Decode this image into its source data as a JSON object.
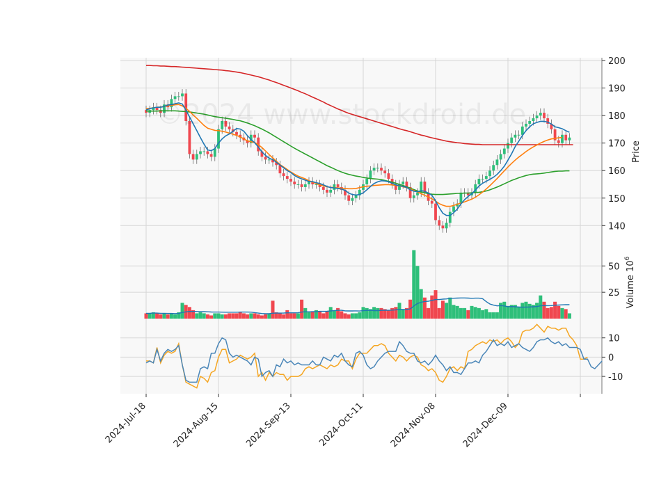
{
  "watermark": "©2024 www.stockdroid.de",
  "colors": {
    "up": "#2ebf7a",
    "down": "#f0474f",
    "panel_bg": "#f8f8f8",
    "grid": "#d6d6d6",
    "ma_short": "#1f77b4",
    "ma_mid": "#ff7f0e",
    "ma_long": "#2ca02c",
    "ma_200": "#d62728",
    "volume_ma": "#1f77b4",
    "osc_fast": "#4a86b8",
    "osc_slow": "#f5a623"
  },
  "chart_data": [
    {
      "type": "candlestick",
      "ylabel": "Price",
      "ylim": [
        133,
        201
      ],
      "yticks": [
        140,
        150,
        160,
        170,
        180,
        190,
        200
      ],
      "xtick_labels": [
        "2024-Jul-18",
        "2024-Aug-15",
        "2024-Sep-13",
        "2024-Oct-11",
        "2024-Nov-08",
        "2024-Dec-09"
      ],
      "xtick_index": [
        0,
        20,
        40,
        60,
        80,
        100
      ],
      "grid": true,
      "close": [
        181,
        182,
        183,
        182,
        181,
        184,
        183,
        186,
        187,
        187,
        188,
        178,
        166,
        164,
        166,
        167,
        167,
        166,
        165,
        168,
        175,
        178,
        176,
        175,
        174,
        173,
        172,
        171,
        170,
        173,
        172,
        167,
        165,
        164,
        164,
        163,
        162,
        159,
        158,
        157,
        156,
        155,
        155,
        154,
        155,
        156,
        155,
        155,
        154,
        153,
        152,
        153,
        155,
        154,
        153,
        151,
        149,
        150,
        151,
        153,
        155,
        157,
        160,
        161,
        161,
        160,
        159,
        157,
        155,
        153,
        155,
        156,
        154,
        150,
        151,
        152,
        156,
        152,
        149,
        148,
        142,
        140,
        139,
        141,
        145,
        147,
        148,
        152,
        152,
        151,
        152,
        155,
        157,
        157,
        158,
        160,
        162,
        164,
        166,
        168,
        170,
        172,
        173,
        173,
        176,
        177,
        178,
        179,
        180,
        181,
        179,
        177,
        175,
        171,
        170,
        173,
        171,
        172
      ],
      "series": [
        {
          "name": "MA short",
          "values": [
            182,
            182.5,
            182.8,
            183,
            183,
            183.3,
            183.8,
            184,
            184.3,
            184.6,
            184.2,
            182,
            179.5,
            177,
            174.5,
            172,
            169.6,
            167.5,
            167.2,
            168,
            170,
            171.5,
            172.6,
            173.3,
            174.3,
            175.3,
            175.1,
            174.3,
            172.7,
            171.3,
            170.1,
            168.6,
            166.8,
            165.5,
            164.5,
            164,
            163,
            162,
            161,
            160,
            159.3,
            158.2,
            157.5,
            157,
            156.5,
            156,
            156,
            155.6,
            155.3,
            154.8,
            154.2,
            153.8,
            153.7,
            153.5,
            153.3,
            152.8,
            151.8,
            151.3,
            151.1,
            151.3,
            151.9,
            153,
            154.2,
            155.3,
            155.9,
            156.3,
            156.2,
            155.9,
            155.4,
            154.8,
            154.5,
            154.2,
            153.9,
            153,
            152.5,
            152.3,
            152.7,
            152.5,
            151.8,
            151,
            149,
            146.5,
            144.5,
            143.7,
            143.7,
            144.7,
            146,
            147.9,
            149.4,
            150.6,
            151.6,
            152.9,
            154.4,
            155.4,
            156.1,
            156.8,
            157.6,
            158.6,
            160,
            161.6,
            163.8,
            166.1,
            168.7,
            170.7,
            172.8,
            174.5,
            175.9,
            177,
            177.5,
            177.9,
            177.9,
            177.6,
            176.9,
            175.9,
            175.6,
            175.2,
            174.5,
            173.9
          ]
        },
        {
          "name": "MA mid",
          "values": [
            182.5,
            182.6,
            182.8,
            183,
            183.1,
            183.3,
            183.5,
            183.7,
            183.9,
            184,
            183.5,
            182.6,
            181.5,
            180.2,
            179,
            177.7,
            176.4,
            175.4,
            175,
            174.6,
            174.5,
            174.3,
            174,
            173.6,
            173.2,
            172.8,
            172.2,
            171.5,
            170.8,
            170.5,
            170.2,
            169.4,
            168.4,
            167.1,
            165.8,
            164.6,
            163.4,
            162.2,
            161.3,
            160.4,
            159.5,
            158.7,
            158,
            157.5,
            157,
            156.3,
            155.8,
            155.3,
            154.8,
            154.4,
            154.1,
            153.9,
            153.8,
            153.7,
            153.6,
            153.5,
            153.4,
            153.4,
            153.5,
            153.8,
            154.1,
            154.3,
            154.4,
            154.6,
            154.7,
            154.8,
            154.9,
            154.9,
            154.8,
            154.6,
            154.4,
            154.1,
            153.8,
            153.3,
            152.8,
            152.2,
            151.6,
            151,
            150.4,
            149.7,
            148.9,
            148,
            147.4,
            147,
            147,
            147.3,
            147.8,
            148.2,
            148.6,
            149.1,
            149.6,
            150.3,
            151.2,
            152.2,
            153.3,
            154.5,
            155.8,
            157.1,
            158.5,
            159.9,
            161.3,
            162.6,
            163.8,
            164.9,
            165.9,
            166.9,
            167.8,
            168.6,
            169.3,
            170,
            170.6,
            171.1,
            171.5,
            171.7,
            171.9,
            172
          ]
        },
        {
          "name": "MA long",
          "values": [
            181.6,
            181.6,
            181.6,
            181.6,
            181.7,
            181.7,
            181.7,
            181.7,
            181.7,
            181.6,
            181.5,
            181.4,
            181.3,
            181.1,
            180.9,
            180.7,
            180.5,
            180.2,
            179.9,
            179.6,
            179.4,
            179.2,
            179,
            178.8,
            178.6,
            178.3,
            178.1,
            177.7,
            177.3,
            176.8,
            176.3,
            175.7,
            175.1,
            174.4,
            173.7,
            172.9,
            172.1,
            171.3,
            170.5,
            169.7,
            168.9,
            168.1,
            167.4,
            166.7,
            166,
            165.3,
            164.6,
            163.9,
            163.2,
            162.5,
            161.8,
            161.2,
            160.6,
            160,
            159.5,
            159,
            158.6,
            158.3,
            158,
            157.8,
            157.5,
            157.3,
            157.1,
            157,
            156.9,
            156.7,
            156.4,
            156.1,
            155.8,
            155.4,
            155,
            154.6,
            154.1,
            153.6,
            153.1,
            152.6,
            152.2,
            151.9,
            151.6,
            151.4,
            151.3,
            151.3,
            151.3,
            151.4,
            151.5,
            151.6,
            151.7,
            151.7,
            151.8,
            151.8,
            151.9,
            152,
            152.1,
            152.3,
            152.6,
            153,
            153.5,
            154,
            154.6,
            155.2,
            155.8,
            156.4,
            156.9,
            157.4,
            157.8,
            158.2,
            158.5,
            158.7,
            158.8,
            158.9,
            159.1,
            159.3,
            159.5,
            159.7,
            159.8,
            159.8,
            159.9,
            159.9
          ]
        },
        {
          "name": "MA 200",
          "values": [
            198.2,
            198.2,
            198.1,
            198.1,
            198,
            198,
            197.9,
            197.8,
            197.8,
            197.7,
            197.6,
            197.5,
            197.4,
            197.3,
            197.2,
            197.1,
            197,
            196.9,
            196.8,
            196.7,
            196.6,
            196.5,
            196.3,
            196.2,
            196,
            195.8,
            195.6,
            195.3,
            195,
            194.7,
            194.4,
            194.1,
            193.7,
            193.3,
            192.9,
            192.4,
            192,
            191.5,
            191,
            190.5,
            190,
            189.5,
            189,
            188.4,
            187.9,
            187.3,
            186.7,
            186.1,
            185.5,
            184.9,
            184.2,
            183.6,
            183,
            182.4,
            181.9,
            181.3,
            180.8,
            180.4,
            180,
            179.6,
            179.2,
            178.8,
            178.4,
            178,
            177.6,
            177.2,
            176.8,
            176.4,
            176,
            175.6,
            175.2,
            174.8,
            174.5,
            174.1,
            173.7,
            173.3,
            172.9,
            172.6,
            172.2,
            171.9,
            171.6,
            171.3,
            171,
            170.7,
            170.5,
            170.3,
            170.1,
            170,
            169.8,
            169.7,
            169.6,
            169.5,
            169.5,
            169.4,
            169.4,
            169.4,
            169.4,
            169.4,
            169.4,
            169.4,
            169.4,
            169.4,
            169.4,
            169.4,
            169.4,
            169.4,
            169.4,
            169.4,
            169.4,
            169.4,
            169.4,
            169.4,
            169.4,
            169.4,
            169.4,
            169.4,
            169.4,
            169.4,
            169.4
          ]
        }
      ]
    },
    {
      "type": "bar",
      "ylabel": "Volume",
      "unit_exponent": "6",
      "ylim": [
        0,
        70
      ],
      "yticks": [
        25,
        50
      ],
      "values": [
        5,
        5,
        6,
        5,
        4,
        5,
        4,
        5,
        4,
        6,
        15,
        13,
        11,
        8,
        5,
        6,
        5,
        4,
        3,
        5,
        5,
        4,
        4,
        5,
        5,
        5,
        6,
        5,
        4,
        5,
        5,
        4,
        3,
        4,
        5,
        17,
        6,
        5,
        4,
        8,
        5,
        5,
        5,
        18,
        10,
        6,
        7,
        8,
        7,
        5,
        7,
        11,
        8,
        10,
        7,
        5,
        4,
        5,
        5,
        6,
        11,
        10,
        9,
        11,
        10,
        10,
        9,
        8,
        10,
        11,
        15,
        9,
        10,
        18,
        65,
        50,
        28,
        20,
        10,
        22,
        27,
        10,
        17,
        15,
        20,
        13,
        12,
        10,
        10,
        8,
        12,
        11,
        10,
        8,
        9,
        6,
        6,
        6,
        15,
        16,
        12,
        13,
        13,
        11,
        15,
        16,
        14,
        13,
        15,
        22,
        16,
        10,
        11,
        16,
        12,
        10,
        9,
        5
      ]
    },
    {
      "type": "line",
      "ylim": [
        -19,
        20
      ],
      "yticks": [
        -10,
        0,
        10
      ],
      "series": [
        {
          "name": "fast",
          "values": [
            -3,
            -2,
            -3,
            4,
            -2,
            2,
            4,
            3,
            4,
            6,
            -4,
            -12,
            -13,
            -13,
            -13,
            -6,
            -5,
            -6,
            2,
            2,
            7,
            10,
            9,
            2,
            0,
            1,
            0,
            -1,
            -2,
            -4,
            0,
            -1,
            -10,
            -8,
            -7,
            -10,
            -4,
            -5,
            -1,
            -3,
            -2,
            -4,
            -3,
            -4,
            -4,
            -4,
            -2,
            -4,
            -4,
            0,
            -1,
            -2,
            1,
            0,
            2,
            -2,
            -4,
            -5,
            2,
            3,
            1,
            -4,
            -6,
            -5,
            -2,
            0,
            2,
            3,
            3,
            3,
            8,
            6,
            3,
            2,
            2,
            -2,
            -3,
            -2,
            -4,
            -2,
            1,
            -2,
            -4,
            -7,
            -5,
            -8,
            -8,
            -9,
            -6,
            -3,
            -3,
            -2,
            -3,
            1,
            3,
            6,
            9,
            6,
            7,
            6,
            8,
            5,
            6,
            7,
            5,
            4,
            3,
            5,
            8,
            9,
            9,
            10,
            8,
            7,
            8,
            6,
            7,
            5,
            5,
            5,
            4,
            -1,
            -1,
            -5,
            -6,
            -4,
            -2
          ]
        },
        {
          "name": "slow",
          "values": [
            -2,
            -2,
            -3,
            5,
            -3,
            1,
            3,
            2,
            3,
            7,
            -4,
            -13,
            -14,
            -15,
            -16,
            -10,
            -11,
            -13,
            -8,
            -7,
            0,
            4,
            4,
            -3,
            -2,
            -1,
            1,
            0,
            -1,
            0,
            2,
            -10,
            -8,
            -12,
            -8,
            -10,
            -8,
            -9,
            -9,
            -12,
            -10,
            -10,
            -10,
            -9,
            -6,
            -5,
            -6,
            -5,
            -4,
            -5,
            -6,
            -4,
            -5,
            -4,
            -1,
            -2,
            -2,
            -6,
            -1,
            2,
            2,
            2,
            4,
            6,
            6,
            7,
            6,
            2,
            0,
            -2,
            1,
            0,
            -2,
            0,
            1,
            0,
            -4,
            -5,
            -7,
            -6,
            -8,
            -12,
            -13,
            -10,
            -6,
            -5,
            -7,
            -5,
            -6,
            3,
            4,
            6,
            7,
            8,
            7,
            9,
            8,
            9,
            7,
            9,
            10,
            8,
            5,
            7,
            13,
            14,
            14,
            15,
            17,
            15,
            13,
            16,
            15,
            15,
            14,
            15,
            15,
            11,
            9,
            6,
            -1,
            -1,
            0
          ]
        }
      ]
    }
  ]
}
